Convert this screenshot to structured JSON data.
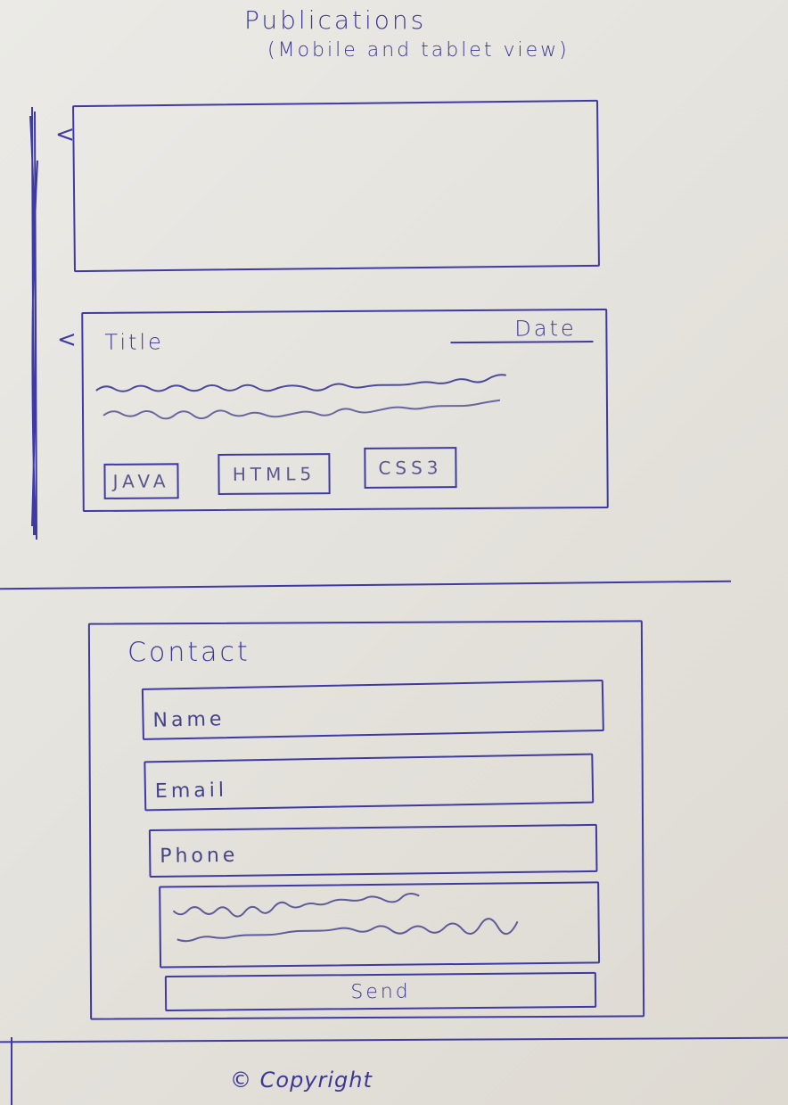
{
  "header": {
    "title": "Publications",
    "subtitle": "(Mobile and tablet view)"
  },
  "publications": {
    "prev_arrow": "<",
    "card": {
      "title": "Title",
      "date": "Date",
      "tags": [
        "JAVA",
        "HTML5",
        "CSS3"
      ]
    }
  },
  "contact": {
    "heading": "Contact",
    "name_placeholder": "Name",
    "email_placeholder": "Email",
    "phone_placeholder": "Phone",
    "send_label": "Send"
  },
  "footer": {
    "copyright": "© Copyright"
  },
  "colors": {
    "ink": "#3f3aa3",
    "paper": "#e4e2dc"
  }
}
